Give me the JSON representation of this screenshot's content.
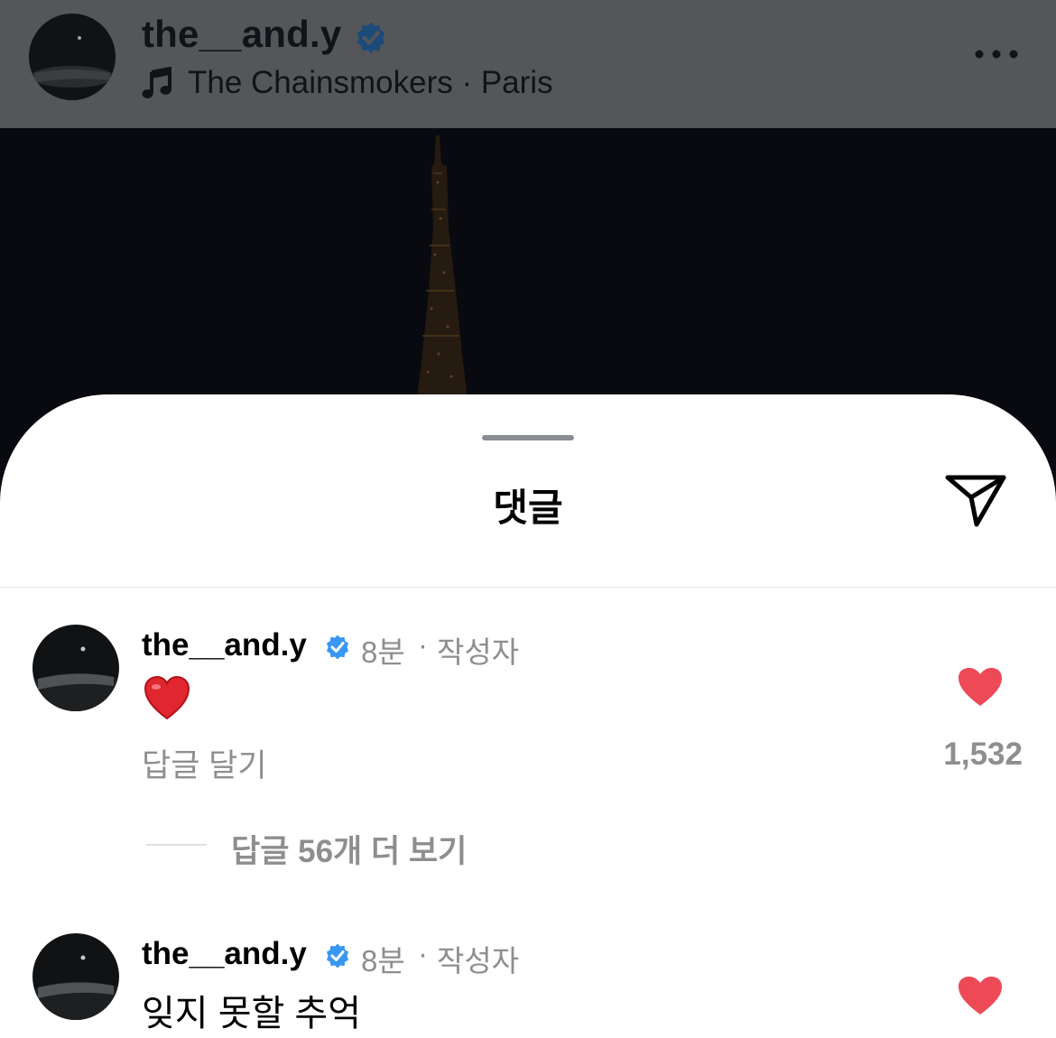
{
  "post": {
    "username": "the__and.y",
    "music_text": "The Chainsmokers · Paris",
    "icons": [
      "verified-badge-icon",
      "music-note-icon",
      "more-options-icon"
    ]
  },
  "sheet": {
    "title": "댓글",
    "share_icon": "paper-plane-icon"
  },
  "comments": [
    {
      "username": "the__and.y",
      "time": "8분",
      "separator": "·",
      "role": "작성자",
      "text": "",
      "emoji": "red-heart-emoji",
      "reply_label": "답글 달기",
      "like_count": "1,532",
      "view_replies": "답글 56개 더 보기"
    },
    {
      "username": "the__and.y",
      "time": "8분",
      "separator": "·",
      "role": "작성자",
      "text": "잊지 못할 추억"
    }
  ],
  "colors": {
    "header_bg": "#545659",
    "like_red": "#ed4956",
    "verified_blue": "#3897f0",
    "muted_text": "#8e8e8e"
  }
}
